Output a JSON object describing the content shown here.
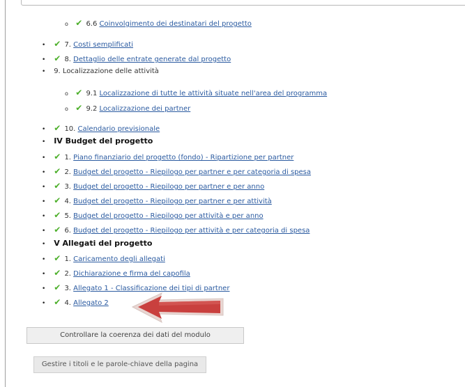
{
  "items": [
    {
      "kind": "sub",
      "check": true,
      "num": "6.6",
      "label": "Coinvolgimento dei destinatari del progetto",
      "link": true
    },
    {
      "kind": "item",
      "check": true,
      "num": "7.",
      "label": "Costi semplificati",
      "link": true
    },
    {
      "kind": "item",
      "check": true,
      "num": "8.",
      "label": "Dettaglio delle entrate generate dal progetto",
      "link": true
    },
    {
      "kind": "item",
      "check": false,
      "num": "9.",
      "label": "Localizzazione delle attività",
      "link": false
    },
    {
      "kind": "sub",
      "check": true,
      "num": "9.1",
      "label": "Localizzazione di tutte le attività situate nell'area del programma",
      "link": true
    },
    {
      "kind": "sub",
      "check": true,
      "num": "9.2",
      "label": "Localizzazione dei partner",
      "link": true
    },
    {
      "kind": "item",
      "check": true,
      "num": "10.",
      "label": "Calendario previsionale",
      "link": true
    },
    {
      "kind": "heading",
      "label": "IV Budget del progetto"
    },
    {
      "kind": "item",
      "check": true,
      "num": "1.",
      "label": "Piano finanziario del progetto (fondo) - Ripartizione per partner",
      "link": true
    },
    {
      "kind": "item",
      "check": true,
      "num": "2.",
      "label": "Budget del progetto - Riepilogo per partner e per categoria di spesa",
      "link": true
    },
    {
      "kind": "item",
      "check": true,
      "num": "3.",
      "label": "Budget del progetto - Riepilogo per partner e per anno",
      "link": true
    },
    {
      "kind": "item",
      "check": true,
      "num": "4.",
      "label": "Budget del progetto - Riepilogo per partner e per attività",
      "link": true
    },
    {
      "kind": "item",
      "check": true,
      "num": "5.",
      "label": "Budget del progetto - Riepilogo per attività e per anno",
      "link": true
    },
    {
      "kind": "item",
      "check": true,
      "num": "6.",
      "label": "Budget del progetto - Riepilogo per attività e per categoria di spesa",
      "link": true
    },
    {
      "kind": "heading",
      "label": "V Allegati del progetto"
    },
    {
      "kind": "item",
      "check": true,
      "num": "1.",
      "label": "Caricamento degli allegati",
      "link": true
    },
    {
      "kind": "item",
      "check": true,
      "num": "2.",
      "label": "Dichiarazione e firma del capofila",
      "link": true
    },
    {
      "kind": "item",
      "check": true,
      "num": "3.",
      "label": "Allegato 1 - Classificazione dei tipi di partner",
      "link": true
    },
    {
      "kind": "item",
      "check": true,
      "num": "4.",
      "label": "Allegato 2",
      "link": true
    }
  ],
  "buttons": {
    "check_consistency": "Controllare la coerenza dei dati del modulo",
    "manage_titles": "Gestire i titoli e le parole-chiave della pagina"
  },
  "glyphs": {
    "bullet": "•",
    "sub_bullet": "o",
    "check": "✔"
  },
  "colors": {
    "link": "#2a5aa0",
    "check": "#4caf2a",
    "arrow_fill": "#c9403e",
    "arrow_outline": "#e9d6d2"
  }
}
